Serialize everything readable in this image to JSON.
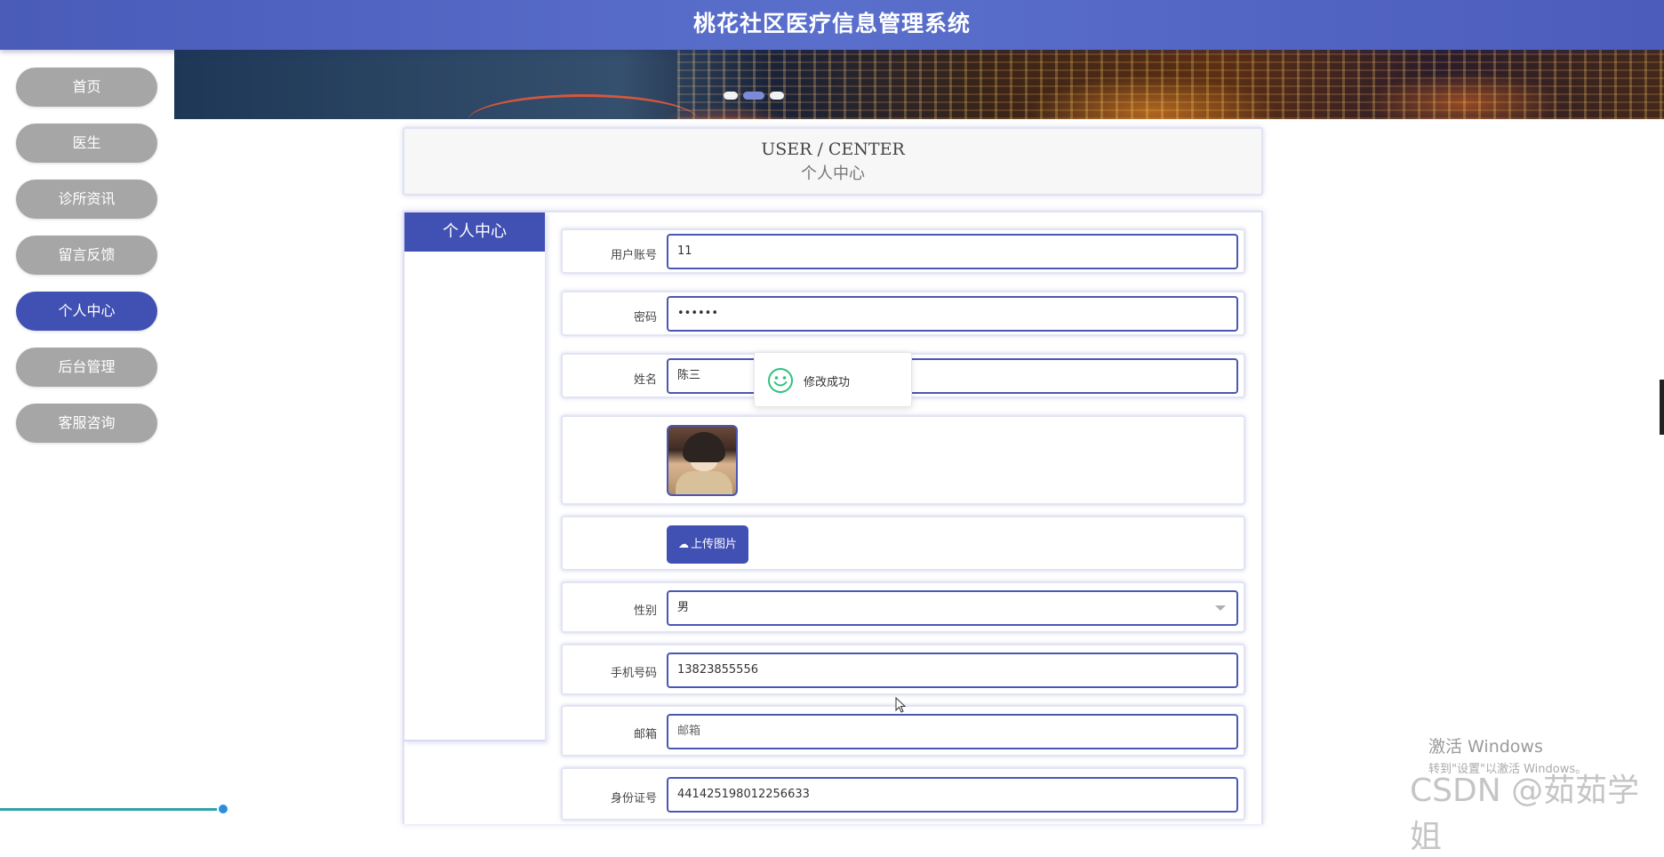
{
  "app": {
    "title": "桃花社区医疗信息管理系统"
  },
  "nav": {
    "items": [
      {
        "label": "首页"
      },
      {
        "label": "医生"
      },
      {
        "label": "诊所资讯"
      },
      {
        "label": "留言反馈"
      },
      {
        "label": "个人中心"
      },
      {
        "label": "后台管理"
      },
      {
        "label": "客服咨询"
      }
    ],
    "active_index": 4
  },
  "banner": {
    "dot_count": 3,
    "active_dot": 1
  },
  "user_center": {
    "title_en": "USER / CENTER",
    "title_cn": "个人中心",
    "tab_label": "个人中心"
  },
  "form": {
    "account_label": "用户账号",
    "account_value": "11",
    "password_label": "密码",
    "password_value": "••••••",
    "name_label": "姓名",
    "name_value": "陈三",
    "upload_label": "上传图片",
    "gender_label": "性别",
    "gender_value": "男",
    "phone_label": "手机号码",
    "phone_value": "13823855556",
    "email_label": "邮箱",
    "email_placeholder": "邮箱",
    "id_label": "身份证号",
    "id_value": "441425198012256633"
  },
  "toast": {
    "message": "修改成功",
    "icon": "smile-icon"
  },
  "watermarks": {
    "activate_title": "激活 Windows",
    "activate_sub": "转到\"设置\"以激活 Windows。",
    "csdn": "CSDN @茹茹学姐"
  },
  "colors": {
    "primary": "#4150b3",
    "nav_inactive": "#a6a6a6",
    "toast_icon": "#2ec27e"
  }
}
